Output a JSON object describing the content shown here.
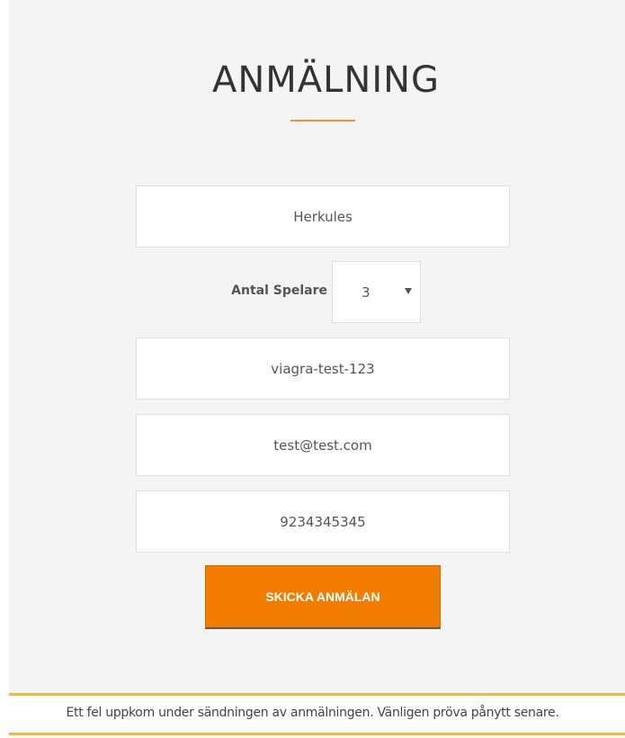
{
  "form": {
    "title": "ANMÄLNING",
    "team_name": "Herkules",
    "players": {
      "label": "Antal Spelare",
      "selected": "3"
    },
    "team_field": "viagra-test-123",
    "email": "test@test.com",
    "phone": "9234345345",
    "submit_label": "SKICKA ANMÄLAN"
  },
  "error": {
    "message": "Ett fel uppkom under sändningen av anmälningen. Vänligen pröva pånytt senare."
  },
  "colors": {
    "accent": "#f27c00",
    "title_rule": "#e69530",
    "error_border": "#f0b840",
    "panel_bg": "#f4f4f4"
  }
}
